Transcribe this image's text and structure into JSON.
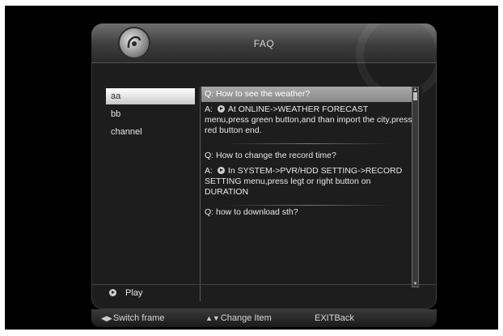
{
  "header": {
    "title": "FAQ",
    "logo_icon": "satellite-dish-logo-icon"
  },
  "left_list": {
    "items": [
      {
        "label": "aa",
        "selected": true
      },
      {
        "label": "bb",
        "selected": false
      },
      {
        "label": "channel",
        "selected": false
      }
    ]
  },
  "faq": [
    {
      "question": "Q: How to see the weather?",
      "answer_prefix": "A:",
      "answer": "At ONLINE->WEATHER FORECAST menu,press green button,and than import the city,press red button end.",
      "selected": true
    },
    {
      "question": "Q: How to change the record time?",
      "answer_prefix": "A:",
      "answer": "In SYSTEM->PVR/HDD SETTING->RECORD SETTING menu,press legt or right button on DURATION",
      "selected": false
    },
    {
      "question": "Q: how to download sth?",
      "answer_prefix": "",
      "answer": "",
      "selected": false
    }
  ],
  "play_row": {
    "label": "Play",
    "icon": "play-icon"
  },
  "bottom_hints": {
    "switch_frame": "Switch frame",
    "change_item": "Change Item",
    "exit_key": "EXIT",
    "exit_label": "Back"
  }
}
